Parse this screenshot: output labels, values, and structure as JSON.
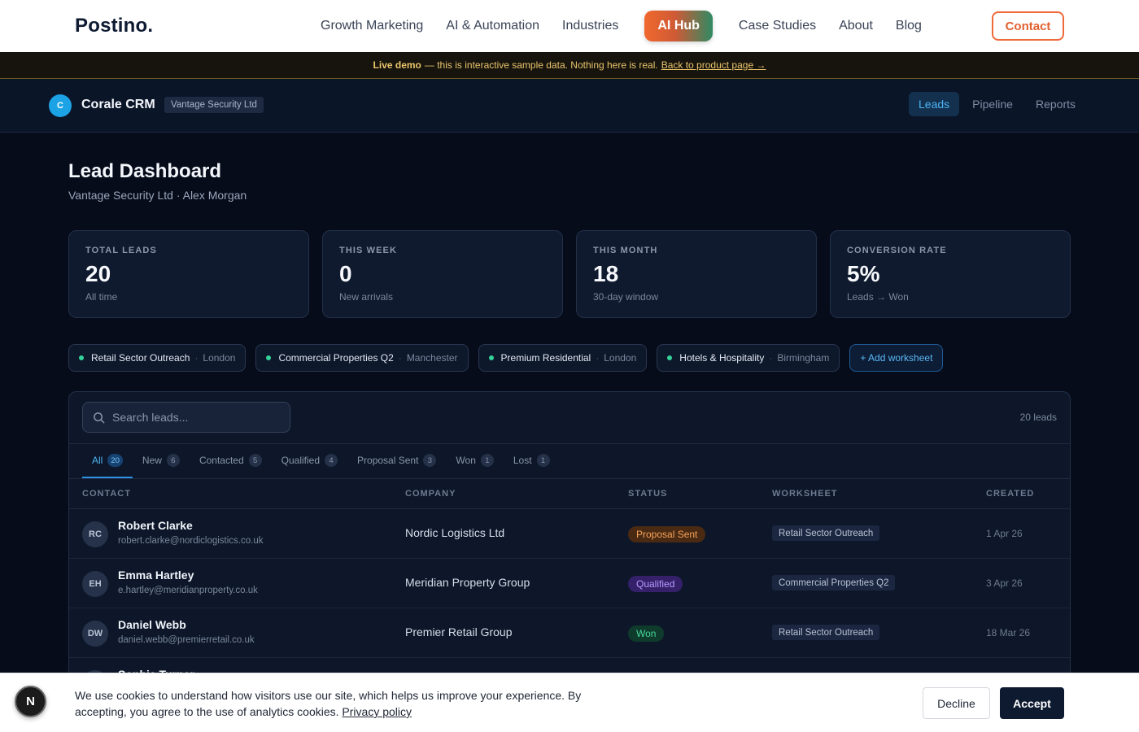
{
  "site": {
    "logo": "Postino.",
    "nav": [
      "Growth Marketing",
      "AI & Automation",
      "Industries"
    ],
    "hub": "AI Hub",
    "nav_after": [
      "Case Studies",
      "About",
      "Blog"
    ],
    "contact": "Contact"
  },
  "banner": {
    "bold": "Live demo",
    "text": "— this is interactive sample data. Nothing here is real.",
    "link": "Back to product page →"
  },
  "app": {
    "badge": "C",
    "name": "Corale CRM",
    "org": "Vantage Security Ltd",
    "tabs": [
      {
        "label": "Leads",
        "active": true
      },
      {
        "label": "Pipeline",
        "active": false
      },
      {
        "label": "Reports",
        "active": false
      }
    ]
  },
  "page": {
    "title": "Lead Dashboard",
    "subtitle": "Vantage Security Ltd · Alex Morgan"
  },
  "stats": [
    {
      "label": "TOTAL LEADS",
      "value": "20",
      "sub": "All time"
    },
    {
      "label": "THIS WEEK",
      "value": "0",
      "sub": "New arrivals"
    },
    {
      "label": "THIS MONTH",
      "value": "18",
      "sub": "30-day window"
    },
    {
      "label": "CONVERSION RATE",
      "value": "5%",
      "sub": "Leads → Won"
    }
  ],
  "worksheets": [
    {
      "name": "Retail Sector Outreach",
      "location": "London"
    },
    {
      "name": "Commercial Properties Q2",
      "location": "Manchester"
    },
    {
      "name": "Premium Residential",
      "location": "London"
    },
    {
      "name": "Hotels & Hospitality",
      "location": "Birmingham"
    }
  ],
  "add_worksheet": "+ Add worksheet",
  "table": {
    "search_placeholder": "Search leads...",
    "lead_count": "20 leads",
    "filters": [
      {
        "label": "All",
        "count": "20",
        "active": true
      },
      {
        "label": "New",
        "count": "6",
        "active": false
      },
      {
        "label": "Contacted",
        "count": "5",
        "active": false
      },
      {
        "label": "Qualified",
        "count": "4",
        "active": false
      },
      {
        "label": "Proposal Sent",
        "count": "3",
        "active": false
      },
      {
        "label": "Won",
        "count": "1",
        "active": false
      },
      {
        "label": "Lost",
        "count": "1",
        "active": false
      }
    ],
    "columns": [
      "CONTACT",
      "COMPANY",
      "STATUS",
      "WORKSHEET",
      "CREATED"
    ],
    "rows": [
      {
        "initials": "RC",
        "name": "Robert Clarke",
        "email": "robert.clarke@nordiclogistics.co.uk",
        "company": "Nordic Logistics Ltd",
        "status": "Proposal Sent",
        "worksheet": "Retail Sector Outreach",
        "created": "1 Apr 26"
      },
      {
        "initials": "EH",
        "name": "Emma Hartley",
        "email": "e.hartley@meridianproperty.co.uk",
        "company": "Meridian Property Group",
        "status": "Qualified",
        "worksheet": "Commercial Properties Q2",
        "created": "3 Apr 26"
      },
      {
        "initials": "DW",
        "name": "Daniel Webb",
        "email": "daniel.webb@premierretail.co.uk",
        "company": "Premier Retail Group",
        "status": "Won",
        "worksheet": "Retail Sector Outreach",
        "created": "18 Mar 26"
      },
      {
        "initials": "ST",
        "name": "Sophie Turner",
        "email": "",
        "company": "",
        "status": "",
        "worksheet": "",
        "created": ""
      }
    ]
  },
  "status_colors": {
    "Proposal Sent": {
      "bg": "#4a2a12",
      "fg": "#f5a35b"
    },
    "Qualified": {
      "bg": "#35206a",
      "fg": "#b69cff"
    },
    "Won": {
      "bg": "#0f3b2c",
      "fg": "#44d69a"
    }
  },
  "cookie": {
    "logo": "N",
    "text": "We use cookies to understand how visitors use our site, which helps us improve your experience. By accepting, you agree to the use of analytics cookies.",
    "policy": "Privacy policy",
    "decline": "Decline",
    "accept": "Accept"
  }
}
